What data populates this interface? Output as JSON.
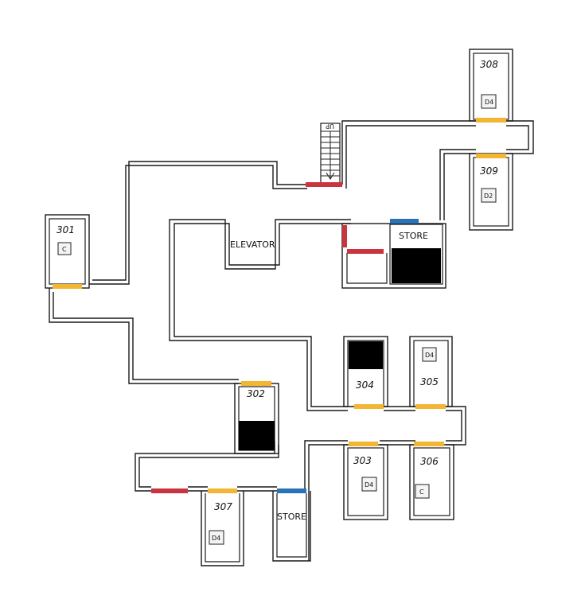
{
  "colors": {
    "door_room": "#f2b632",
    "door_red": "#c9343f",
    "door_store": "#2a73b8",
    "blocked": "#000000"
  },
  "labels": {
    "elevator": "ELEVATOR",
    "store_upper": "STORE",
    "store_lower": "STORE",
    "stairs": "UP"
  },
  "rooms": {
    "r301": {
      "number": "301",
      "tag": "C"
    },
    "r302": {
      "number": "302"
    },
    "r303": {
      "number": "303",
      "tag": "D4"
    },
    "r304": {
      "number": "304"
    },
    "r305": {
      "number": "305",
      "tag": "D4"
    },
    "r306": {
      "number": "306",
      "tag": "C"
    },
    "r307": {
      "number": "307",
      "tag": "D4"
    },
    "r308": {
      "number": "308",
      "tag": "D4"
    },
    "r309": {
      "number": "309",
      "tag": "D2"
    }
  }
}
